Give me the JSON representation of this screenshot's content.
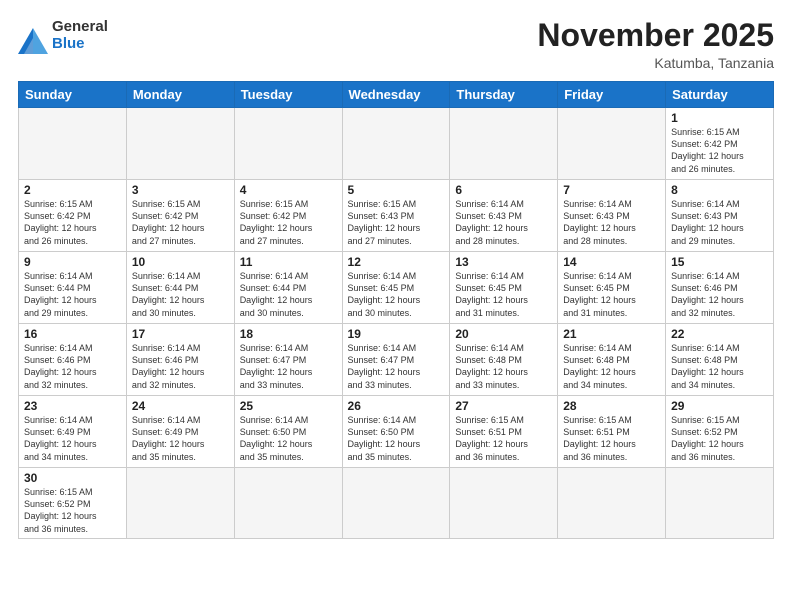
{
  "logo": {
    "text_general": "General",
    "text_blue": "Blue"
  },
  "header": {
    "month": "November 2025",
    "location": "Katumba, Tanzania"
  },
  "weekdays": [
    "Sunday",
    "Monday",
    "Tuesday",
    "Wednesday",
    "Thursday",
    "Friday",
    "Saturday"
  ],
  "weeks": [
    [
      {
        "day": "",
        "empty": true
      },
      {
        "day": "",
        "empty": true
      },
      {
        "day": "",
        "empty": true
      },
      {
        "day": "",
        "empty": true
      },
      {
        "day": "",
        "empty": true
      },
      {
        "day": "",
        "empty": true
      },
      {
        "day": "1",
        "rise": "6:15 AM",
        "set": "6:42 PM",
        "hours": "12 hours and 26 minutes."
      }
    ],
    [
      {
        "day": "2",
        "rise": "6:15 AM",
        "set": "6:42 PM",
        "hours": "12 hours and 26 minutes."
      },
      {
        "day": "3",
        "rise": "6:15 AM",
        "set": "6:42 PM",
        "hours": "12 hours and 27 minutes."
      },
      {
        "day": "4",
        "rise": "6:15 AM",
        "set": "6:42 PM",
        "hours": "12 hours and 27 minutes."
      },
      {
        "day": "5",
        "rise": "6:15 AM",
        "set": "6:43 PM",
        "hours": "12 hours and 27 minutes."
      },
      {
        "day": "6",
        "rise": "6:14 AM",
        "set": "6:43 PM",
        "hours": "12 hours and 28 minutes."
      },
      {
        "day": "7",
        "rise": "6:14 AM",
        "set": "6:43 PM",
        "hours": "12 hours and 28 minutes."
      },
      {
        "day": "8",
        "rise": "6:14 AM",
        "set": "6:43 PM",
        "hours": "12 hours and 29 minutes."
      }
    ],
    [
      {
        "day": "9",
        "rise": "6:14 AM",
        "set": "6:44 PM",
        "hours": "12 hours and 29 minutes."
      },
      {
        "day": "10",
        "rise": "6:14 AM",
        "set": "6:44 PM",
        "hours": "12 hours and 30 minutes."
      },
      {
        "day": "11",
        "rise": "6:14 AM",
        "set": "6:44 PM",
        "hours": "12 hours and 30 minutes."
      },
      {
        "day": "12",
        "rise": "6:14 AM",
        "set": "6:45 PM",
        "hours": "12 hours and 30 minutes."
      },
      {
        "day": "13",
        "rise": "6:14 AM",
        "set": "6:45 PM",
        "hours": "12 hours and 31 minutes."
      },
      {
        "day": "14",
        "rise": "6:14 AM",
        "set": "6:45 PM",
        "hours": "12 hours and 31 minutes."
      },
      {
        "day": "15",
        "rise": "6:14 AM",
        "set": "6:46 PM",
        "hours": "12 hours and 32 minutes."
      }
    ],
    [
      {
        "day": "16",
        "rise": "6:14 AM",
        "set": "6:46 PM",
        "hours": "12 hours and 32 minutes."
      },
      {
        "day": "17",
        "rise": "6:14 AM",
        "set": "6:46 PM",
        "hours": "12 hours and 32 minutes."
      },
      {
        "day": "18",
        "rise": "6:14 AM",
        "set": "6:47 PM",
        "hours": "12 hours and 33 minutes."
      },
      {
        "day": "19",
        "rise": "6:14 AM",
        "set": "6:47 PM",
        "hours": "12 hours and 33 minutes."
      },
      {
        "day": "20",
        "rise": "6:14 AM",
        "set": "6:48 PM",
        "hours": "12 hours and 33 minutes."
      },
      {
        "day": "21",
        "rise": "6:14 AM",
        "set": "6:48 PM",
        "hours": "12 hours and 34 minutes."
      },
      {
        "day": "22",
        "rise": "6:14 AM",
        "set": "6:48 PM",
        "hours": "12 hours and 34 minutes."
      }
    ],
    [
      {
        "day": "23",
        "rise": "6:14 AM",
        "set": "6:49 PM",
        "hours": "12 hours and 34 minutes."
      },
      {
        "day": "24",
        "rise": "6:14 AM",
        "set": "6:49 PM",
        "hours": "12 hours and 35 minutes."
      },
      {
        "day": "25",
        "rise": "6:14 AM",
        "set": "6:50 PM",
        "hours": "12 hours and 35 minutes."
      },
      {
        "day": "26",
        "rise": "6:14 AM",
        "set": "6:50 PM",
        "hours": "12 hours and 35 minutes."
      },
      {
        "day": "27",
        "rise": "6:15 AM",
        "set": "6:51 PM",
        "hours": "12 hours and 36 minutes."
      },
      {
        "day": "28",
        "rise": "6:15 AM",
        "set": "6:51 PM",
        "hours": "12 hours and 36 minutes."
      },
      {
        "day": "29",
        "rise": "6:15 AM",
        "set": "6:52 PM",
        "hours": "12 hours and 36 minutes."
      }
    ],
    [
      {
        "day": "30",
        "rise": "6:15 AM",
        "set": "6:52 PM",
        "hours": "12 hours and 36 minutes."
      },
      {
        "day": "",
        "empty": true
      },
      {
        "day": "",
        "empty": true
      },
      {
        "day": "",
        "empty": true
      },
      {
        "day": "",
        "empty": true
      },
      {
        "day": "",
        "empty": true
      },
      {
        "day": "",
        "empty": true
      }
    ]
  ],
  "labels": {
    "sunrise": "Sunrise:",
    "sunset": "Sunset:",
    "daylight": "Daylight:"
  }
}
